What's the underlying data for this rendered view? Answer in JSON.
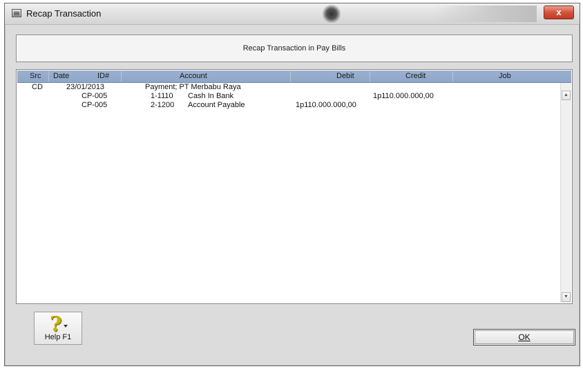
{
  "window": {
    "title": "Recap Transaction",
    "close_label": "x"
  },
  "banner": {
    "text": "Recap Transaction in Pay Bills"
  },
  "grid": {
    "columns": [
      "Src",
      "Date",
      "ID#",
      "Account",
      "Debit",
      "Credit",
      "Job"
    ],
    "rows": [
      {
        "src": "CD",
        "date": "23/01/2013",
        "id": "",
        "account_no": "Payment; PT Merbabu Raya",
        "account_name": "",
        "debit": "",
        "credit": "",
        "job": ""
      },
      {
        "src": "",
        "date": "",
        "id": "CP-005",
        "account_no": "1-1110",
        "account_name": "Cash In Bank",
        "debit": "",
        "credit": "1p110.000.000,00",
        "job": ""
      },
      {
        "src": "",
        "date": "",
        "id": "CP-005",
        "account_no": "2-1200",
        "account_name": "Account Payable",
        "debit": "1p110.000.000,00",
        "credit": "",
        "job": ""
      }
    ]
  },
  "buttons": {
    "help_label": "Help F1",
    "ok_label": "OK"
  }
}
